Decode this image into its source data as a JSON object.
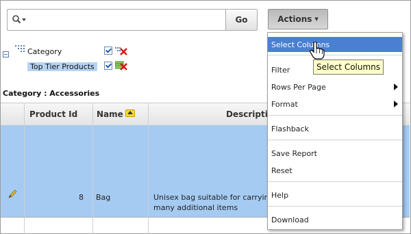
{
  "search": {
    "placeholder": "",
    "value": "",
    "go_label": "Go"
  },
  "actions": {
    "label": "Actions"
  },
  "filters": [
    {
      "label": "Category"
    },
    {
      "label": "Top Tier Products"
    }
  ],
  "group_heading": "Category : Accessories",
  "table": {
    "columns": [
      "",
      "Product Id",
      "Name",
      "Descriptio"
    ],
    "rows": [
      {
        "product_id": "8",
        "name": "Bag",
        "description_line1": "Unisex bag suitable for carrying",
        "description_line2": "many additional items"
      }
    ]
  },
  "menu": {
    "items": [
      {
        "label": "Select Columns",
        "active": true
      },
      {
        "label": "Filter"
      },
      {
        "label": "Rows Per Page",
        "submenu": true
      },
      {
        "label": "Format",
        "submenu": true
      },
      {
        "label": "Flashback"
      },
      {
        "label": "Save Report"
      },
      {
        "label": "Reset"
      },
      {
        "label": "Help"
      },
      {
        "label": "Download"
      }
    ]
  },
  "tooltip": "Select Columns",
  "colors": {
    "menu_highlight": "#4a7fd1",
    "row_selected": "#a5cbf2",
    "filter_highlight": "#b6d4f2",
    "tooltip_bg": "#ffffc8"
  }
}
